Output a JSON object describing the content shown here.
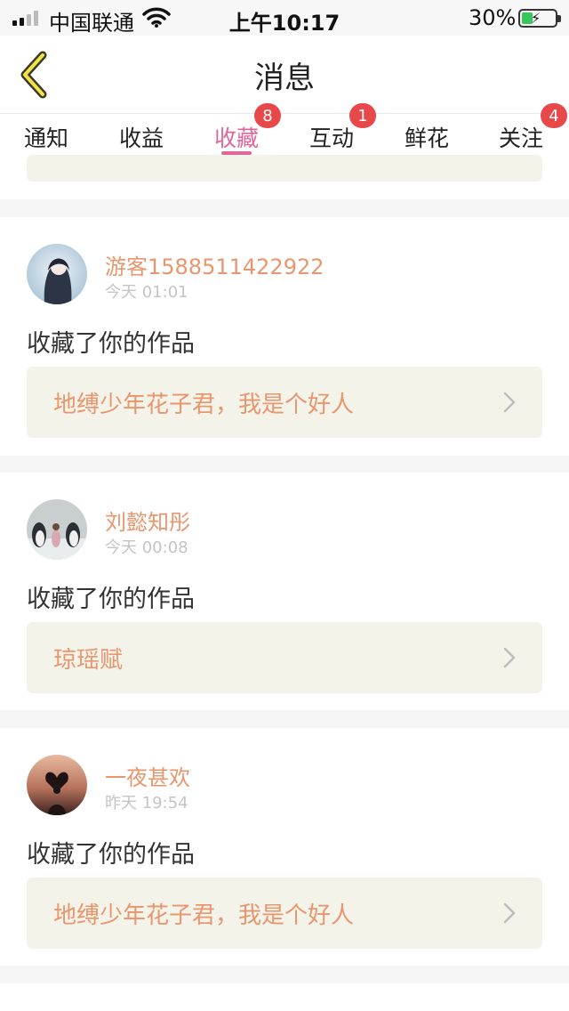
{
  "status": {
    "carrier": "中国联通",
    "time": "上午10:17",
    "battery": "30%"
  },
  "header": {
    "title": "消息"
  },
  "tabs": [
    {
      "label": "通知",
      "badge": ""
    },
    {
      "label": "收益",
      "badge": ""
    },
    {
      "label": "收藏",
      "badge": "8",
      "active": true
    },
    {
      "label": "互动",
      "badge": "1"
    },
    {
      "label": "鲜花",
      "badge": ""
    },
    {
      "label": "关注",
      "badge": "4"
    }
  ],
  "messages": [
    {
      "user": "游客1588511422922",
      "time": "今天 01:01",
      "action": "收藏了你的作品",
      "work": "地缚少年花子君，我是个好人"
    },
    {
      "user": "刘懿知彤",
      "time": "今天 00:08",
      "action": "收藏了你的作品",
      "work": "琼瑶赋"
    },
    {
      "user": "一夜甚欢",
      "time": "昨天 19:54",
      "action": "收藏了你的作品",
      "work": "地缚少年花子君，我是个好人"
    }
  ],
  "colors": {
    "accent_pink": "#e0669a",
    "username_orange": "#e8966e",
    "badge_red": "#e8484a",
    "work_box_bg": "#f4f3ea"
  }
}
